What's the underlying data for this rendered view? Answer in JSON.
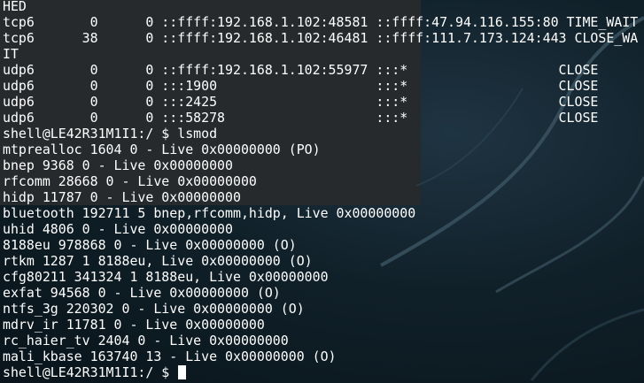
{
  "terminal": {
    "lines": [
      "HED",
      "tcp6       0      0 ::ffff:192.168.1.102:48581 ::ffff:47.94.116.155:80 TIME_WAIT",
      "tcp6      38      0 ::ffff:192.168.1.102:46481 ::ffff:111.7.173.124:443 CLOSE_WA",
      "IT",
      "udp6       0      0 ::ffff:192.168.1.102:55977 :::*                   CLOSE",
      "udp6       0      0 :::1900                    :::*                   CLOSE",
      "udp6       0      0 :::2425                    :::*                   CLOSE",
      "udp6       0      0 :::58278                   :::*                   CLOSE",
      "shell@LE42R31M1I1:/ $ lsmod",
      "mtprealloc 1604 0 - Live 0x00000000 (PO)",
      "bnep 9368 0 - Live 0x00000000",
      "rfcomm 28668 0 - Live 0x00000000",
      "hidp 11787 0 - Live 0x00000000",
      "bluetooth 192711 5 bnep,rfcomm,hidp, Live 0x00000000",
      "uhid 4806 0 - Live 0x00000000",
      "8188eu 978868 0 - Live 0x00000000 (O)",
      "rtkm 1287 1 8188eu, Live 0x00000000 (O)",
      "cfg80211 341324 1 8188eu, Live 0x00000000",
      "exfat 94568 0 - Live 0x00000000 (O)",
      "ntfs_3g 220302 0 - Live 0x00000000 (O)",
      "mdrv_ir 11781 0 - Live 0x00000000",
      "rc_haier_tv 2404 0 - Live 0x00000000",
      "mali_kbase 163740 13 - Live 0x00000000 (O)"
    ],
    "prompt": "shell@LE42R31M1I1:/ $ "
  }
}
